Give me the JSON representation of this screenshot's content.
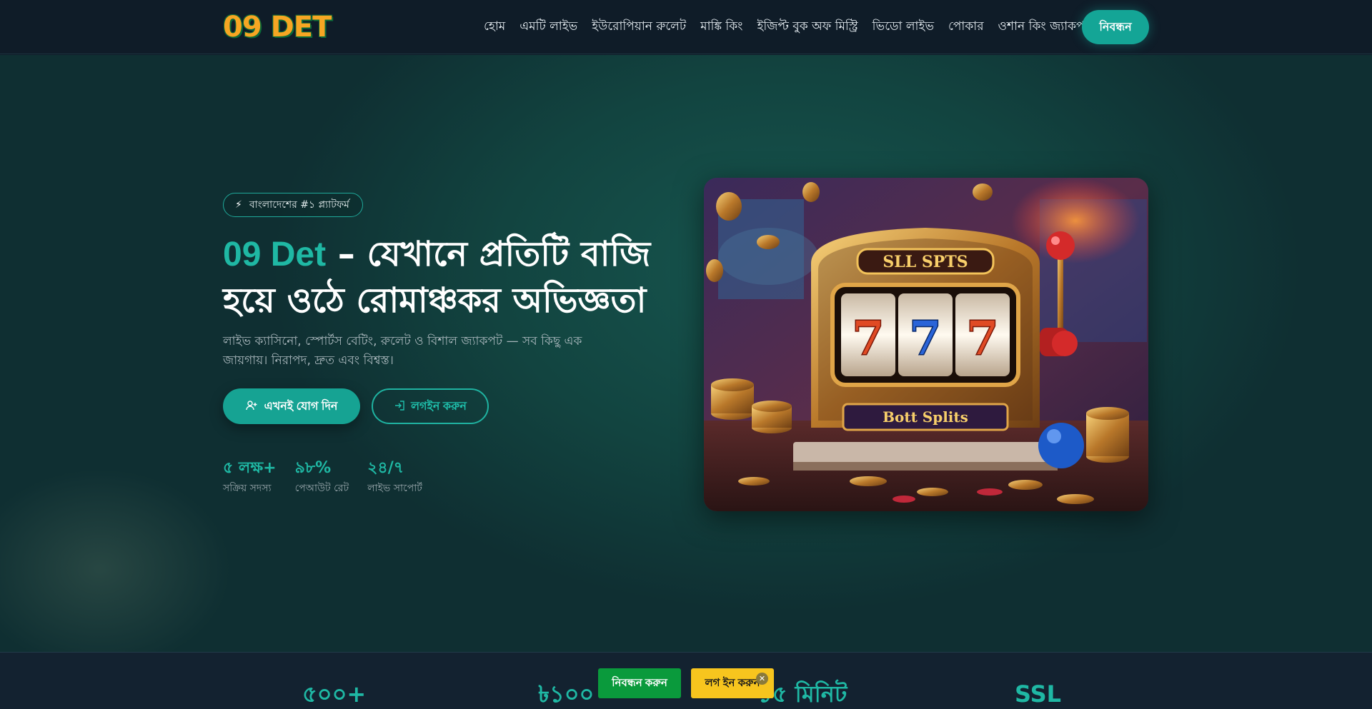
{
  "header": {
    "logo": "09 DET",
    "nav": [
      "হোম",
      "এমটি লাইভ",
      "ইউরোপিয়ান রুলেট",
      "মাঙ্কি কিং",
      "ইজিপ্ট বুক অফ মিস্ট্রি",
      "ভিডো লাইভ",
      "পোকার",
      "ওশান কিং জ্যাকপট"
    ],
    "register_label": "নিবন্ধন"
  },
  "hero": {
    "badge_icon": "bolt-icon",
    "badge_text": "বাংলাদেশের #১ প্ল্যাটফর্ম",
    "title_brand": "09 Det",
    "title_rest": " – যেখানে প্রতিটি বাজি হয়ে ওঠে রোমাঞ্চকর অভিজ্ঞতা",
    "subtitle": "লাইভ ক্যাসিনো, স্পোর্টস বেটিং, রুলেট ও বিশাল জ্যাকপট — সব কিছু এক জায়গায়। নিরাপদ, দ্রুত এবং বিশ্বস্ত।",
    "join_button": "এখনই যোগ দিন",
    "login_button": "লগইন করুন",
    "stats": [
      {
        "value": "৫ লক্ষ+",
        "label": "সক্রিয় সদস্য"
      },
      {
        "value": "৯৮%",
        "label": "পেআউট রেট"
      },
      {
        "value": "২৪/৭",
        "label": "লাইভ সাপোর্ট"
      }
    ],
    "image": {
      "top_sign": "SLL SPTS",
      "bottom_sign": "Bott Splits",
      "reels": [
        "7",
        "7",
        "7"
      ]
    }
  },
  "strip": {
    "items": [
      "৫০০+",
      "৳১০০",
      "১৫ মিনিট",
      "SSL"
    ]
  },
  "floating": {
    "register": "নিবন্ধন করুন",
    "login": "লগ ইন করুন",
    "close": "✕"
  },
  "colors": {
    "accent": "#1fb8a4",
    "header_bg": "#0f1c28",
    "register_green": "#0a9a3c",
    "login_yellow": "#f7c51e"
  }
}
